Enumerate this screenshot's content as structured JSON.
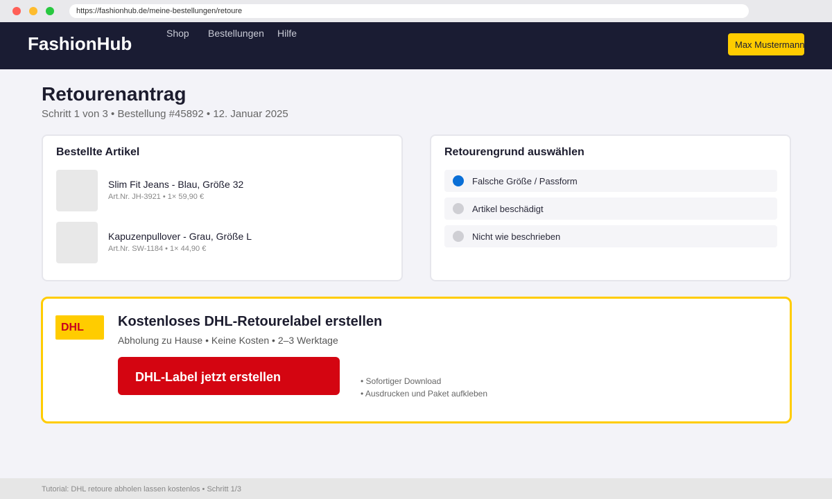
{
  "browser": {
    "url": "https://fashionhub.de/meine-bestellungen/retoure"
  },
  "header": {
    "brand": "FashionHub",
    "nav": [
      "Shop",
      "Bestellungen",
      "Hilfe"
    ],
    "user": "Max Mustermann"
  },
  "page": {
    "title": "Retourenantrag",
    "subtitle": "Schritt 1 von 3 • Bestellung #45892 • 12. Januar 2025"
  },
  "articles": {
    "title": "Bestellte Artikel",
    "items": [
      {
        "name": "Slim Fit Jeans - Blau, Größe 32",
        "meta": "Art.Nr. JH-3921 • 1× 59,90 €"
      },
      {
        "name": "Kapuzenpullover - Grau, Größe L",
        "meta": "Art.Nr. SW-1184 • 1× 44,90 €"
      }
    ]
  },
  "reasons": {
    "title": "Retourengrund auswählen",
    "options": [
      {
        "label": "Falsche Größe / Passform",
        "selected": true
      },
      {
        "label": "Artikel beschädigt",
        "selected": false
      },
      {
        "label": "Nicht wie beschrieben",
        "selected": false
      }
    ]
  },
  "dhl": {
    "logo": "DHL",
    "title": "Kostenloses DHL-Retourelabel erstellen",
    "subtitle": "Abholung zu Hause • Keine Kosten • 2–3 Werktage",
    "button": "DHL-Label jetzt erstellen",
    "features": [
      "• Sofortiger Download",
      "• Ausdrucken und Paket aufkleben"
    ]
  },
  "footer": {
    "text": "Tutorial: DHL retoure abholen lassen kostenlos • Schritt 1/3"
  },
  "colors": {
    "header_bg": "#1a1c33",
    "accent_yellow": "#ffcc00",
    "dhl_red": "#d40511",
    "radio_selected": "#0a6fd6"
  }
}
